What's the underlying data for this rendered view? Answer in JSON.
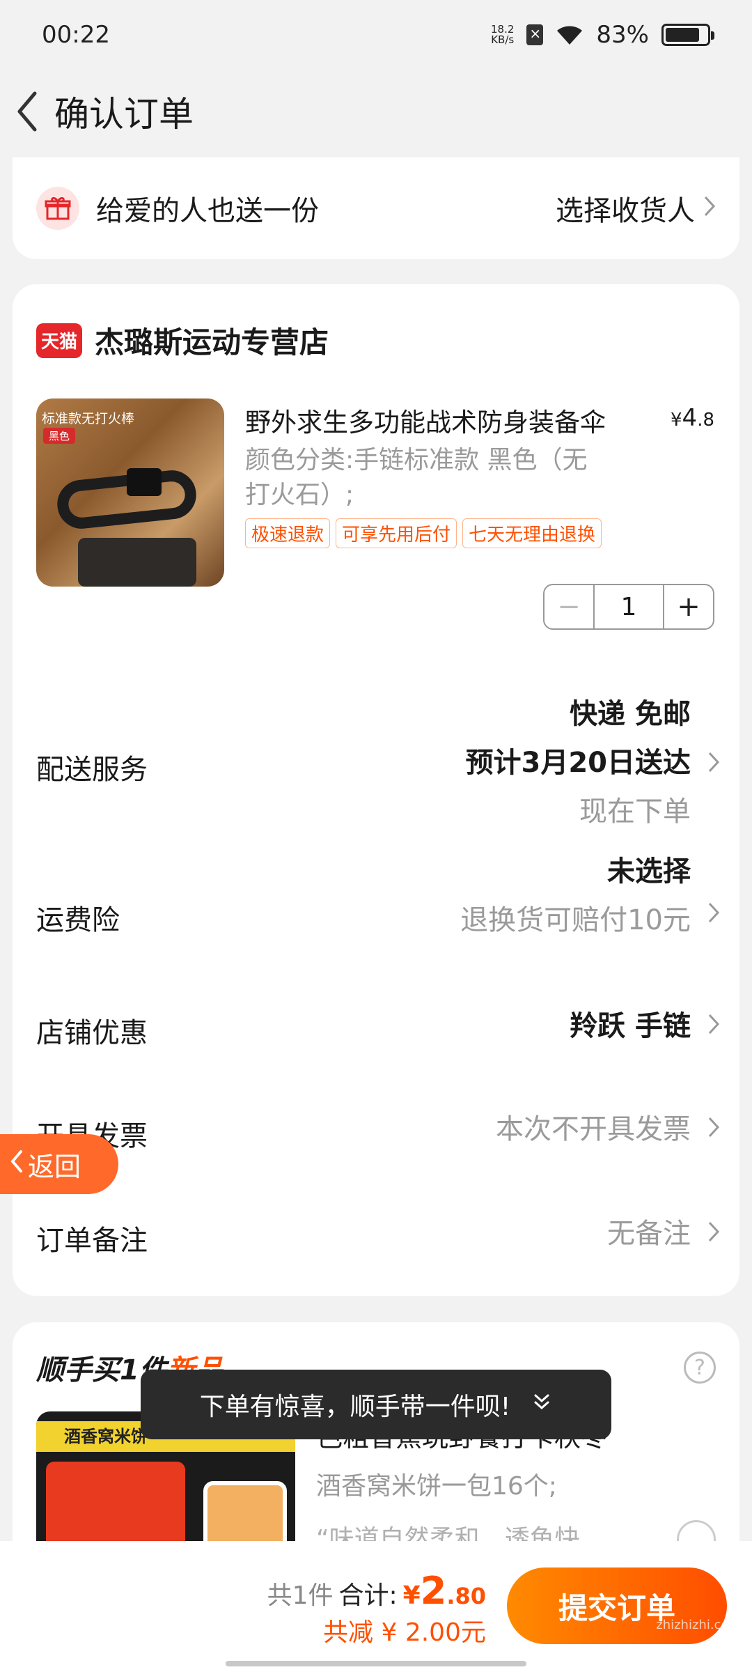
{
  "status_bar": {
    "time": "00:22",
    "net_speed_value": "18.2",
    "net_speed_unit": "KB/s",
    "battery_percent": "83%",
    "battery_level": 0.83,
    "icons": [
      "sim-icon",
      "wifi-icon",
      "battery-icon"
    ]
  },
  "nav": {
    "title": "确认订单",
    "back_icon": "chevron-left-icon"
  },
  "gift": {
    "text": "给爱的人也送一份",
    "action": "选择收货人",
    "icon": "gift-icon"
  },
  "shop": {
    "badge": "天猫",
    "name": "杰璐斯运动专营店"
  },
  "product": {
    "title": "野外求生多功能战术防身装备伞",
    "price_yen": "¥",
    "price_int": "4",
    "price_dec": ".8",
    "sku": "颜色分类:手链标准款 黑色（无打火石）;",
    "image_tag1": "标准款无打火棒",
    "image_tag2": "黑色",
    "tags": [
      "极速退款",
      "可享先用后付",
      "七天无理由退换"
    ],
    "quantity": "1",
    "minus": "−",
    "plus": "+"
  },
  "rows": {
    "delivery": {
      "label": "配送服务",
      "line1": "快递 免邮",
      "line2": "预计3月20日送达",
      "line3": "现在下单"
    },
    "insurance": {
      "label": "运费险",
      "line1": "未选择",
      "line2": "退换货可赔付10元"
    },
    "coupon": {
      "label": "店铺优惠",
      "value": "羚跃 手链"
    },
    "invoice": {
      "label": "开具发票",
      "value": "本次不开具发票"
    },
    "note": {
      "label": "订单备注",
      "value": "无备注"
    }
  },
  "recommend": {
    "title_prefix": "顺手买1件",
    "title_new": "新品",
    "help": "?",
    "item_title": "色粗香蕉玩野餐打卡秋冬",
    "item_sub": "酒香窝米饼一包16个;",
    "item_quote": "“味道自然柔和，透鱼快",
    "image_band": "酒香窝米饼"
  },
  "toast": {
    "text": "下单有惊喜，顺手带一件呗!",
    "icon": "double-chevron-down-icon"
  },
  "back_float": {
    "label": "返回"
  },
  "bottom": {
    "count": "共1件",
    "total_label": "合计:",
    "total_yen": "¥",
    "total_int": "2",
    "total_dec": ".80",
    "discount": "共减 ¥ 2.00元",
    "submit": "提交订单",
    "watermark": "zhizhizhi.com"
  },
  "colors": {
    "accent": "#ff5000",
    "tmall": "#e5262a"
  }
}
